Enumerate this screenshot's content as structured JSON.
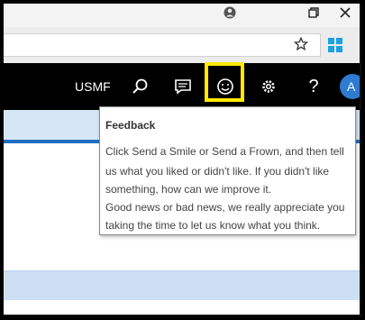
{
  "browser": {
    "profile_icon": "person-circle-icon",
    "restore_icon": "restore-window-icon",
    "close_icon": "close-icon",
    "favorite_icon": "star-icon",
    "windows_logo": "windows-logo-icon"
  },
  "navbar": {
    "company": "USMF",
    "icons": [
      "search-icon",
      "message-icon",
      "smiley-icon",
      "gear-icon",
      "help-icon"
    ],
    "help_glyph": "?",
    "avatar_initial": "A",
    "highlight_color": "#ffea00"
  },
  "tooltip": {
    "title": "Feedback",
    "lines": [
      "Click Send a Smile or Send a Frown, and then tell",
      "us what you liked or didn't like. If you didn't like",
      "something, how can we improve it.",
      "Good news or bad news, we really appreciate you",
      "taking the time to let us know what you think."
    ]
  },
  "colors": {
    "nav_background": "#000000",
    "accent_blue": "#1f6fc0",
    "band_blue": "#d7e6f6"
  }
}
